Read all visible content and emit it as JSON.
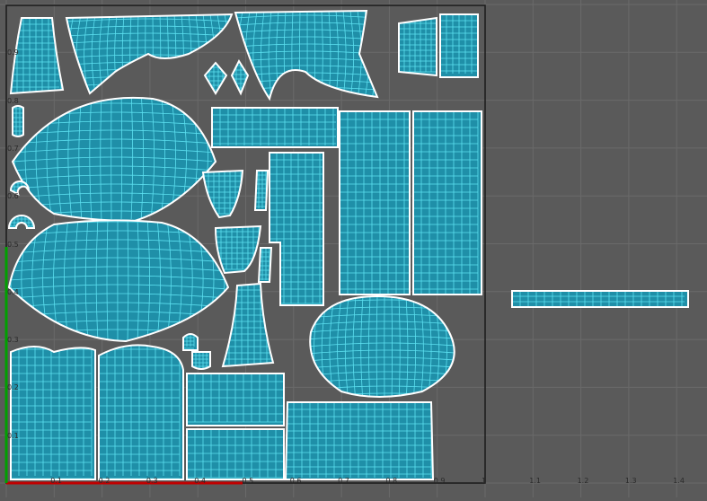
{
  "editor": {
    "background_color": "#5a5a5a",
    "grid_color": "#6a6a6a",
    "wire_color": "#5ce0f0",
    "fill_color": "#1f8fa8",
    "border_color": "#ffffff",
    "u_axis_color": "#c00000",
    "v_axis_color": "#00a000"
  },
  "axis": {
    "u_labels": [
      "0.1",
      "0.2",
      "0.3",
      "0.4",
      "0.5",
      "0.6",
      "0.7",
      "0.8",
      "0.9",
      "1",
      "1.1",
      "1.2",
      "1.3",
      "1.4"
    ],
    "v_labels": [
      "0.9",
      "0.8",
      "0.7",
      "0.6",
      "0.5",
      "0.4",
      "0.3",
      "0.2",
      "0.1"
    ]
  },
  "status": {
    "zoom_hint": ""
  }
}
